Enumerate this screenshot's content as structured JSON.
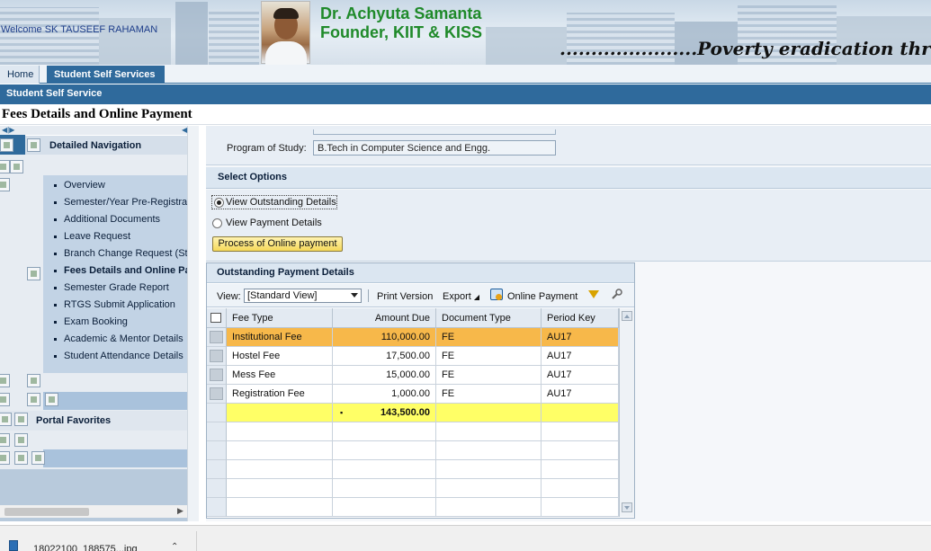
{
  "banner": {
    "welcome": "Welcome SK TAUSEEF RAHAMAN",
    "founder_name": "Dr. Achyuta Samanta",
    "founder_title": "Founder, KIIT & KISS",
    "tagline": "......................Poverty eradication through ed"
  },
  "topnav": {
    "tabs": [
      {
        "label": "Home"
      },
      {
        "label": "Student Self Services"
      }
    ]
  },
  "subnav": {
    "label": "Student Self Service"
  },
  "page": {
    "title": "Fees Details and Online Payment"
  },
  "leftnav": {
    "title": "Detailed Navigation",
    "items": [
      {
        "label": "Overview"
      },
      {
        "label": "Semester/Year Pre-Registra"
      },
      {
        "label": "Additional Documents"
      },
      {
        "label": "Leave Request"
      },
      {
        "label": "Branch Change Request (St"
      },
      {
        "label": "Fees Details and Online Pa"
      },
      {
        "label": "Semester Grade Report"
      },
      {
        "label": "RTGS Submit Application"
      },
      {
        "label": "Exam Booking"
      },
      {
        "label": "Academic & Mentor Details"
      },
      {
        "label": "Student Attendance Details"
      }
    ],
    "favorites_title": "Portal Favorites"
  },
  "program": {
    "label": "Program of Study:",
    "value": "B.Tech in Computer Science and Engg."
  },
  "options": {
    "title": "Select Options",
    "radio1": "View Outstanding Details",
    "radio2": "View Payment Details",
    "selected": "View Outstanding Details",
    "button": "Process of Online payment"
  },
  "outstanding": {
    "title": "Outstanding Payment Details",
    "toolbar": {
      "view_label": "View:",
      "view_value": "[Standard View]",
      "print": "Print Version",
      "export": "Export",
      "online_payment": "Online Payment"
    },
    "columns": [
      "Fee Type",
      "Amount Due",
      "Document Type",
      "Period Key"
    ],
    "rows": [
      {
        "fee_type": "Institutional Fee",
        "amount": "110,000.00",
        "doc": "FE",
        "period": "AU17"
      },
      {
        "fee_type": "Hostel Fee",
        "amount": "17,500.00",
        "doc": "FE",
        "period": "AU17"
      },
      {
        "fee_type": "Mess Fee",
        "amount": "15,000.00",
        "doc": "FE",
        "period": "AU17"
      },
      {
        "fee_type": "Registration Fee",
        "amount": "1,000.00",
        "doc": "FE",
        "period": "AU17"
      }
    ],
    "total": "143,500.00"
  },
  "download": {
    "filename": "18022100_188575...jpg"
  },
  "colors": {
    "accent": "#2f6a9c",
    "highlight": "#f7b84a",
    "total": "#ffff66",
    "founder_text": "#1f8a2a"
  }
}
